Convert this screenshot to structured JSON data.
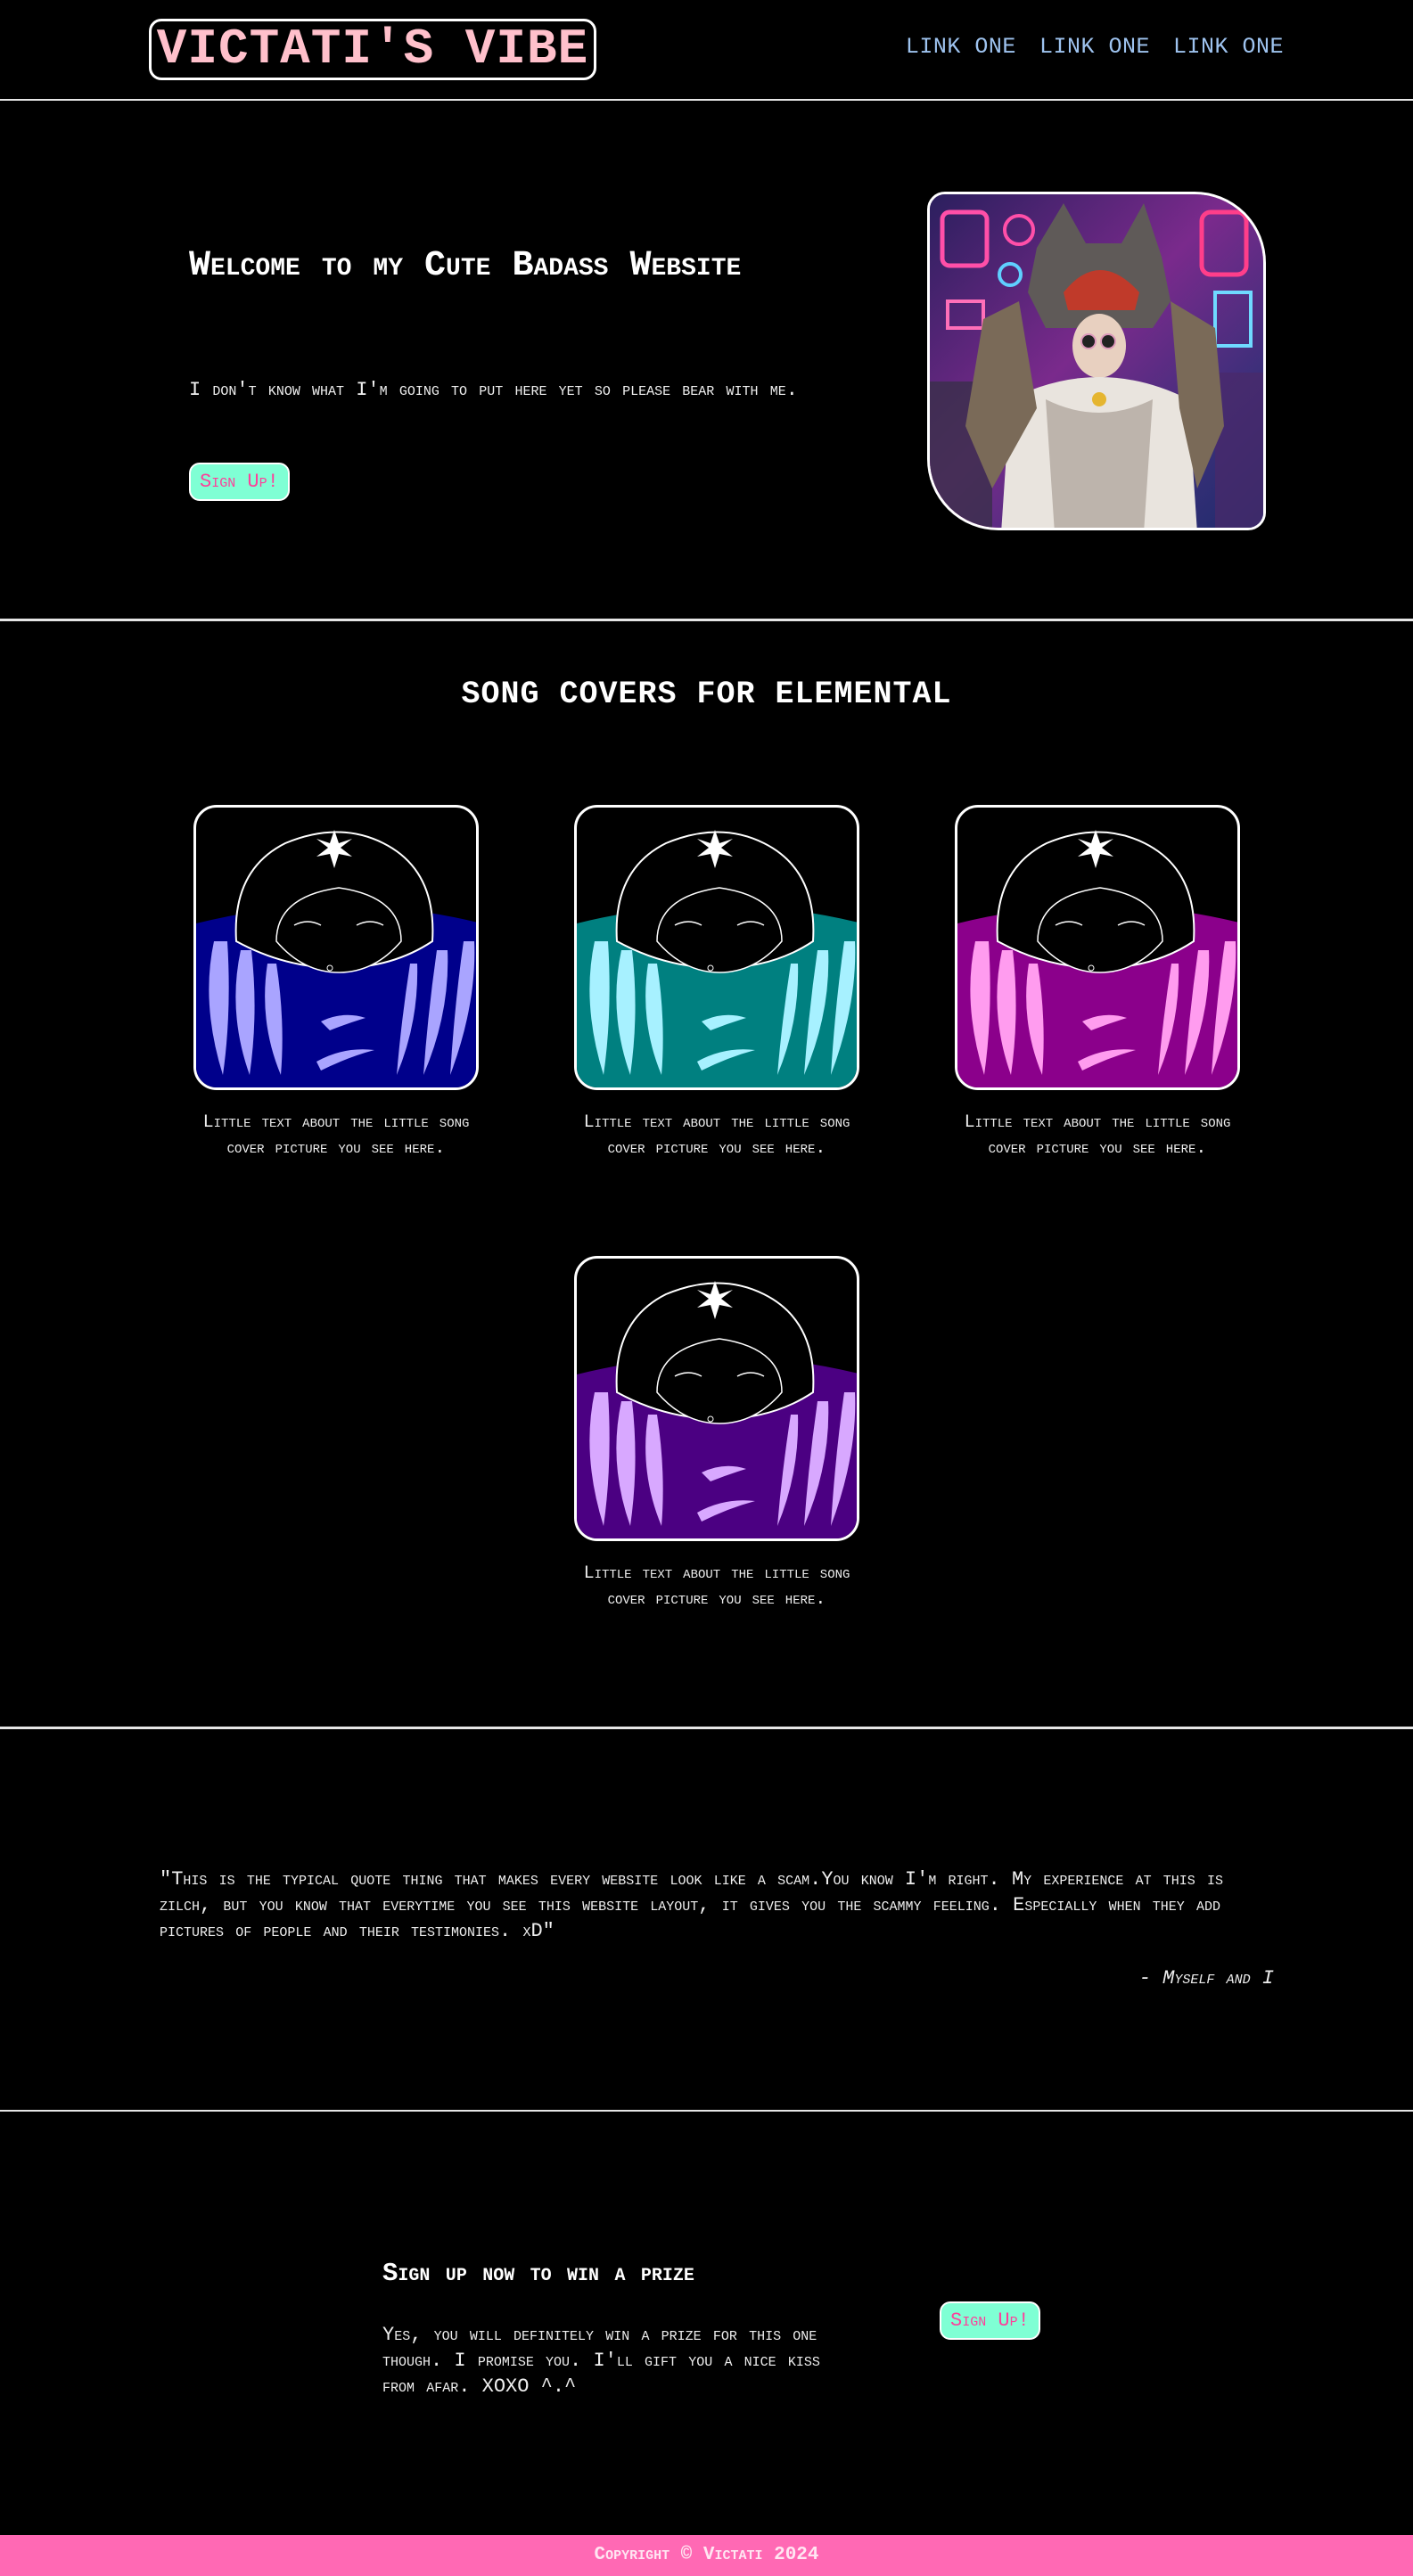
{
  "nav": {
    "logo": "VICTATI'S VIBE",
    "links": [
      "LINK ONE",
      "LINK ONE",
      "LINK ONE"
    ]
  },
  "hero": {
    "title": "Welcome to my Cute Badass Website",
    "text": "I don't know what I'm going to put here yet so please bear with me.",
    "button": "Sign Up!"
  },
  "covers": {
    "title": "SONG COVERS FOR ELEMENTAL",
    "items": [
      {
        "caption": "Little text about the little song cover picture you see here.",
        "color": "#00008b",
        "accent": "#a9a4ff"
      },
      {
        "caption": "Little text about the little song cover picture you see here.",
        "color": "#008080",
        "accent": "#a7f1ff"
      },
      {
        "caption": "Little text about the little song cover picture you see here.",
        "color": "#8b008b",
        "accent": "#ff9cef"
      },
      {
        "caption": "Little text about the little song cover picture you see here.",
        "color": "#4b0082",
        "accent": "#d8a8ff"
      }
    ]
  },
  "quote": {
    "text": "\"This is the typical quote thing that makes every website look like a scam.You know I'm right. My experience at this is zilch, but you know that everytime you see this website layout, it gives you the scammy feeling. Especially when they add pictures of people and their testimonies. xD\"",
    "author": "- Myself and I"
  },
  "signup": {
    "title": "Sign up now to win a prize",
    "text": "Yes, you will definitely win a prize for this one though. I promise you. I'll gift you a nice kiss from afar. XOXO ^.^",
    "button": "Sign Up!"
  },
  "footer": {
    "text": "Copyright © Victati 2024"
  },
  "colors": {
    "logo": "#ffc0cb",
    "links": "#9ec3ef",
    "button_bg": "#7fffd4",
    "button_text": "#ff3e9a",
    "footer_bg": "#ff69b4"
  }
}
